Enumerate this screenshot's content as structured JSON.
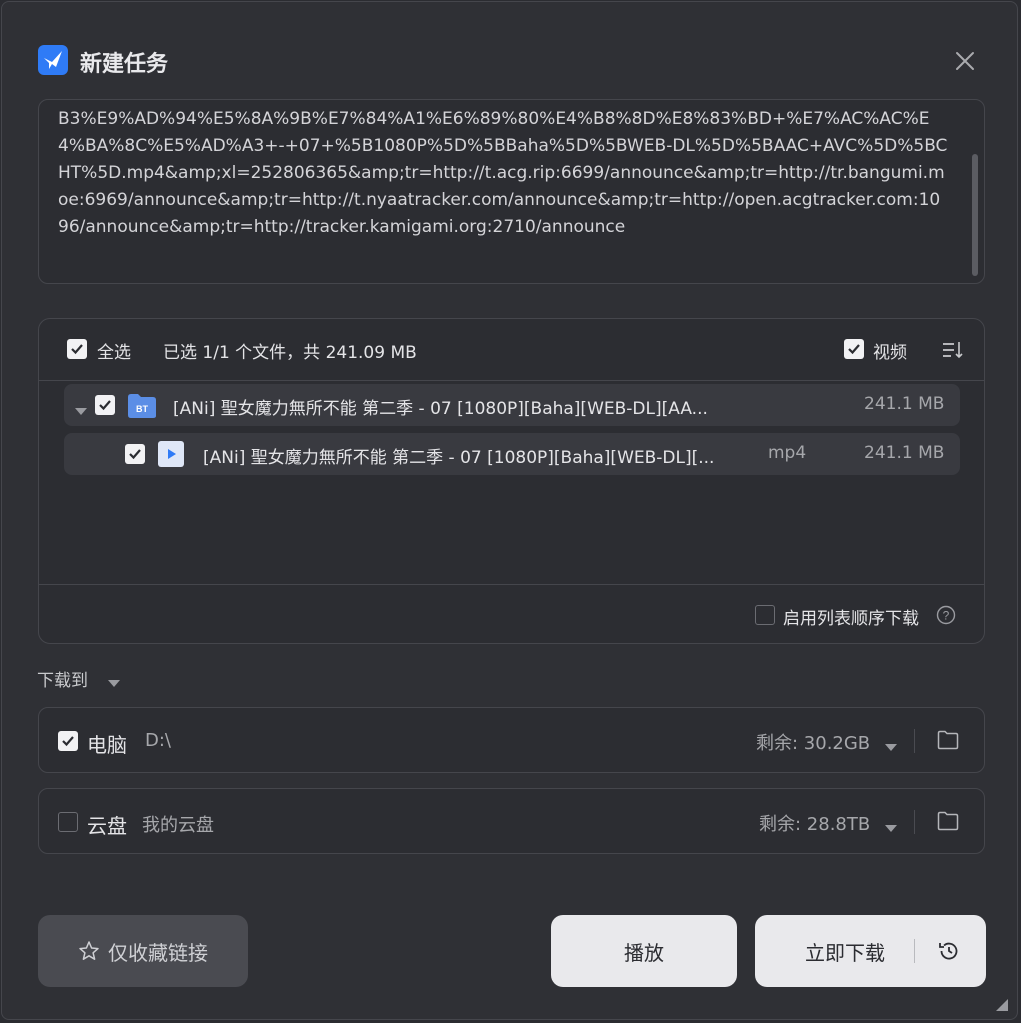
{
  "title": "新建任务",
  "link": {
    "text": "B3%E9%AD%94%E5%8A%9B%E7%84%A1%E6%89%80%E4%B8%8D%E8%83%BD+%E7%AC%AC%E4%BA%8C%E5%AD%A3+-+07+%5B1080P%5D%5BBaha%5D%5BWEB-DL%5D%5BAAC+AVC%5D%5BCHT%5D.mp4&amp;xl=252806365&amp;tr=http://t.acg.rip:6699/announce&amp;tr=http://tr.bangumi.moe:6969/announce&amp;tr=http://t.nyaatracker.com/announce&amp;tr=http://open.acgtracker.com:1096/announce&amp;tr=http://tracker.kamigami.org:2710/announce"
  },
  "files": {
    "select_all_label": "全选",
    "selected_summary": "已选 1/1 个文件，共 241.09 MB",
    "video_filter_label": "视频",
    "items": [
      {
        "name": "[ANi] 聖女魔力無所不能 第二季 - 07 [1080P][Baha][WEB-DL][AA...",
        "icon": "BT",
        "type": "",
        "size": "241.1 MB"
      },
      {
        "name": "[ANi] 聖女魔力無所不能 第二季 - 07 [1080P][Baha][WEB-DL][...",
        "icon": "video-file-icon",
        "type": "mp4",
        "size": "241.1 MB"
      }
    ],
    "sequential_label": "启用列表顺序下载"
  },
  "download_to": {
    "label": "下载到",
    "pc": {
      "label": "电脑",
      "path": "D:\\",
      "remaining": "剩余: 30.2GB",
      "checked": true
    },
    "cloud": {
      "label": "云盘",
      "path": "我的云盘",
      "remaining": "剩余: 28.8TB",
      "checked": false
    }
  },
  "buttons": {
    "favorite": "仅收藏链接",
    "play": "播放",
    "download": "立即下载"
  },
  "colors": {
    "accent": "#2f7bf6",
    "background": "#2f3035",
    "button_light": "#e9e9ec"
  }
}
